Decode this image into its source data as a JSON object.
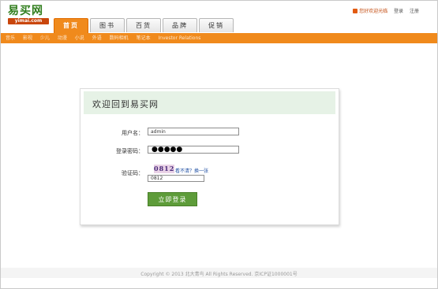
{
  "header": {
    "logo_text": "易买网",
    "logo_sub": "yimai.com",
    "top_links": {
      "notice": "您好欢迎光临",
      "login": "登录",
      "register": "注册"
    }
  },
  "tabs": [
    {
      "label": "首页",
      "active": true
    },
    {
      "label": "图书",
      "active": false
    },
    {
      "label": "百货",
      "active": false
    },
    {
      "label": "品牌",
      "active": false
    },
    {
      "label": "促销",
      "active": false
    }
  ],
  "subnav": [
    "音乐",
    "影视",
    "少儿",
    "动漫",
    "小说",
    "外语",
    "数码相机",
    "笔记本",
    "Investor Relations"
  ],
  "login": {
    "title": "欢迎回到易买网",
    "username_label": "用户名：",
    "username_value": "admin",
    "password_label": "登录密码：",
    "password_masked": "●●●●●",
    "captcha_label": "验证码：",
    "captcha_text": "0812",
    "captcha_refresh": "看不清？换一张",
    "captcha_value": "0812",
    "submit_label": "立即登录"
  },
  "footer": {
    "copyright": "Copyright © 2013 北大青鸟 All Rights Reserved. 京ICP证1000001号"
  },
  "colors": {
    "brand_green": "#2f7d1c",
    "nav_orange": "#f08a1c",
    "button_green": "#5e9c3a"
  }
}
